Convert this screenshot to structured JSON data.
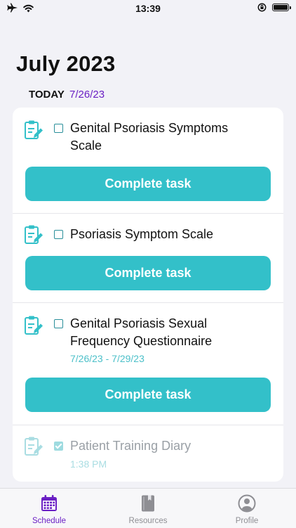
{
  "status_bar": {
    "time": "13:39",
    "icons": [
      "airplane-icon",
      "wifi-icon",
      "orientation-lock-icon",
      "battery-icon"
    ]
  },
  "header": {
    "month": "July 2023",
    "today_label": "TODAY",
    "today_date": "7/26/23"
  },
  "tasks": [
    {
      "title": "Genital Psoriasis Symptoms Scale",
      "subtitle": "",
      "checked": false,
      "button": "Complete task"
    },
    {
      "title": "Psoriasis Symptom Scale",
      "subtitle": "",
      "checked": false,
      "button": "Complete task"
    },
    {
      "title": "Genital Psoriasis Sexual Frequency Questionnaire",
      "subtitle": "7/26/23 - 7/29/23",
      "checked": false,
      "button": "Complete task"
    },
    {
      "title": "Patient Training Diary",
      "subtitle": "1:38 PM",
      "checked": true,
      "button": ""
    }
  ],
  "tab_bar": {
    "items": [
      {
        "label": "Schedule",
        "icon": "calendar-icon",
        "active": true
      },
      {
        "label": "Resources",
        "icon": "book-icon",
        "active": false
      },
      {
        "label": "Profile",
        "icon": "person-icon",
        "active": false
      }
    ]
  },
  "colors": {
    "accent": "#6a1fc4",
    "button": "#33c0c9",
    "background": "#f2f2f7"
  }
}
